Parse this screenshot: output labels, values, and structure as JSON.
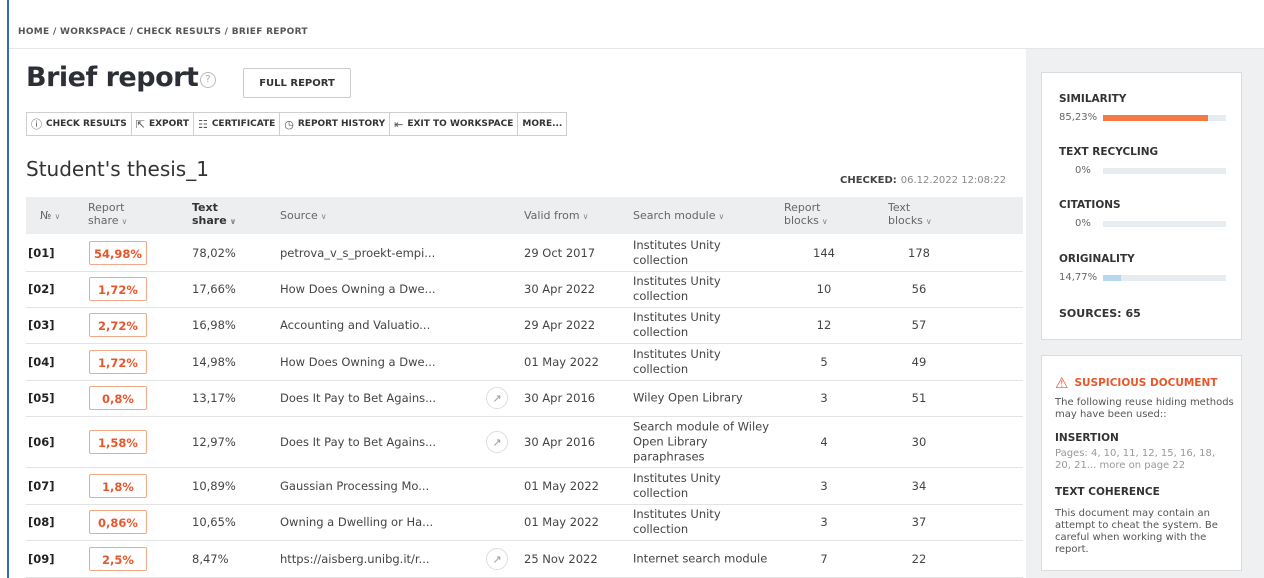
{
  "breadcrumb": [
    "HOME",
    "/",
    "WORKSPACE",
    "/",
    "CHECK RESULTS",
    "/",
    "BRIEF REPORT"
  ],
  "title": "Brief report",
  "help_icon": "?",
  "full_report_label": "FULL REPORT",
  "toolbar": {
    "check_results": "CHECK RESULTS",
    "export": "EXPORT",
    "certificate": "CERTIFICATE",
    "report_history": "REPORT HISTORY",
    "exit": "EXIT TO WORKSPACE",
    "more": "MORE..."
  },
  "document_name": "Student's thesis_1",
  "checked_label": "CHECKED:",
  "checked_date": "06.12.2022 12:08:22",
  "table": {
    "headers": {
      "no": "№",
      "report_share_1": "Report",
      "report_share_2": "share",
      "text_share_1": "Text",
      "text_share_2": "share",
      "source": "Source",
      "valid_from": "Valid from",
      "search_module": "Search module",
      "report_blocks_1": "Report",
      "report_blocks_2": "blocks",
      "text_blocks_1": "Text",
      "text_blocks_2": "blocks"
    },
    "rows": [
      {
        "no": "[01]",
        "report_share": "54,98%",
        "text_share": "78,02%",
        "source": "petrova_v_s_proekt-empi...",
        "valid_from": "29 Oct 2017",
        "module": "Institutes Unity collection",
        "report_blocks": "144",
        "text_blocks": "178",
        "link": false
      },
      {
        "no": "[02]",
        "report_share": "1,72%",
        "text_share": "17,66%",
        "source": "How Does Owning a Dwe...",
        "valid_from": "30 Apr 2022",
        "module": "Institutes Unity collection",
        "report_blocks": "10",
        "text_blocks": "56",
        "link": false
      },
      {
        "no": "[03]",
        "report_share": "2,72%",
        "text_share": "16,98%",
        "source": "Accounting and Valuatio...",
        "valid_from": "29 Apr 2022",
        "module": "Institutes Unity collection",
        "report_blocks": "12",
        "text_blocks": "57",
        "link": false
      },
      {
        "no": "[04]",
        "report_share": "1,72%",
        "text_share": "14,98%",
        "source": "How Does Owning a Dwe...",
        "valid_from": "01 May 2022",
        "module": "Institutes Unity collection",
        "report_blocks": "5",
        "text_blocks": "49",
        "link": false
      },
      {
        "no": "[05]",
        "report_share": "0,8%",
        "text_share": "13,17%",
        "source": "Does It Pay to Bet Agains...",
        "valid_from": "30 Apr 2016",
        "module": "Wiley Open Library",
        "report_blocks": "3",
        "text_blocks": "51",
        "link": true
      },
      {
        "no": "[06]",
        "report_share": "1,58%",
        "text_share": "12,97%",
        "source": "Does It Pay to Bet Agains...",
        "valid_from": "30 Apr 2016",
        "module": "Search module of Wiley Open Library paraphrases",
        "report_blocks": "4",
        "text_blocks": "30",
        "link": true
      },
      {
        "no": "[07]",
        "report_share": "1,8%",
        "text_share": "10,89%",
        "source": "Gaussian Processing Mo...",
        "valid_from": "01 May 2022",
        "module": "Institutes Unity collection",
        "report_blocks": "3",
        "text_blocks": "34",
        "link": false
      },
      {
        "no": "[08]",
        "report_share": "0,86%",
        "text_share": "10,65%",
        "source": "Owning a Dwelling or Ha...",
        "valid_from": "01 May 2022",
        "module": "Institutes Unity collection",
        "report_blocks": "3",
        "text_blocks": "37",
        "link": false
      },
      {
        "no": "[09]",
        "report_share": "2,5%",
        "text_share": "8,47%",
        "source": "https://aisberg.unibg.it/r...",
        "valid_from": "25 Nov 2022",
        "module": "Internet search module",
        "report_blocks": "7",
        "text_blocks": "22",
        "link": true
      }
    ]
  },
  "summary": {
    "similarity": {
      "label": "SIMILARITY",
      "value": "85,23%",
      "fraction": 0.8523,
      "color": "#f47a45"
    },
    "text_recycling": {
      "label": "TEXT RECYCLING",
      "value": "0%",
      "fraction": 0,
      "color": "#f47a45"
    },
    "citations": {
      "label": "CITATIONS",
      "value": "0%",
      "fraction": 0,
      "color": "#4ea6dc"
    },
    "originality": {
      "label": "ORIGINALITY",
      "value": "14,77%",
      "fraction": 0.1477,
      "color": "#b7d7ef"
    },
    "sources_label": "SOURCES:",
    "sources_count": "65"
  },
  "warning": {
    "title": "SUSPICIOUS DOCUMENT",
    "intro": "The following reuse hiding methods may have been used::",
    "insertion_label": "INSERTION",
    "insertion_pages": "Pages: 4, 10, 11, 12, 15, 16, 18, 20, 21... more on page 22",
    "coherence_label": "TEXT COHERENCE",
    "coherence_text": "This document may contain an attempt to cheat the system. Be careful when working with the report."
  },
  "icons": {
    "sort": "chevron-down-icon",
    "link": "link-icon",
    "warning": "warning-triangle-icon"
  }
}
